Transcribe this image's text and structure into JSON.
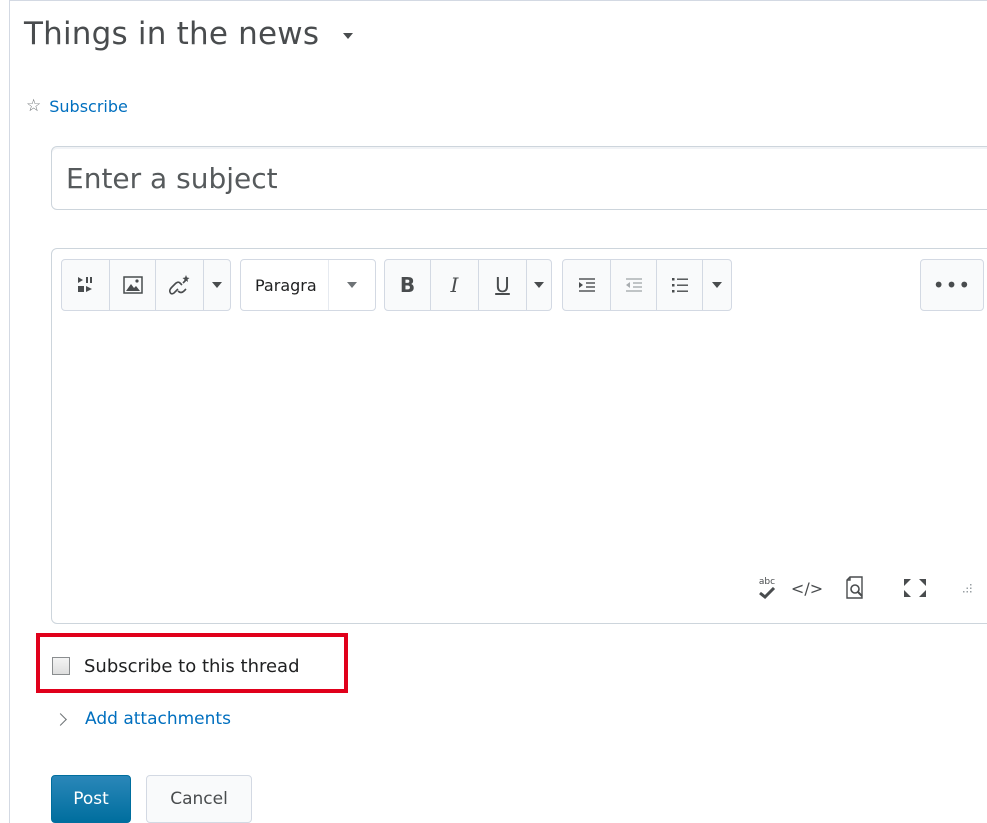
{
  "topic": {
    "title": "Things in the news"
  },
  "subscribe_link": "Subscribe",
  "subject": {
    "placeholder": "Enter a subject",
    "value": ""
  },
  "editor": {
    "format_select": "Paragra",
    "more_button": "•••",
    "bold_label": "B",
    "italic_label": "I",
    "underline_label": "U",
    "spellcheck_label": "abc",
    "source_label": "</>",
    "icons": [
      "insert-media-icon",
      "insert-image-icon",
      "insert-link-icon",
      "bold-icon",
      "italic-icon",
      "underline-icon",
      "indent-icon",
      "outdent-icon",
      "bullet-list-icon",
      "spellcheck-icon",
      "source-code-icon",
      "preview-icon",
      "fullscreen-icon",
      "resize-handle-icon"
    ]
  },
  "subscribe_thread": {
    "label": "Subscribe to this thread",
    "checked": false
  },
  "attachments_link": "Add attachments",
  "buttons": {
    "post": "Post",
    "cancel": "Cancel"
  },
  "colors": {
    "link": "#006fbf",
    "primary": "#006e9e",
    "highlight": "#e0001b",
    "text": "#494c4e"
  }
}
